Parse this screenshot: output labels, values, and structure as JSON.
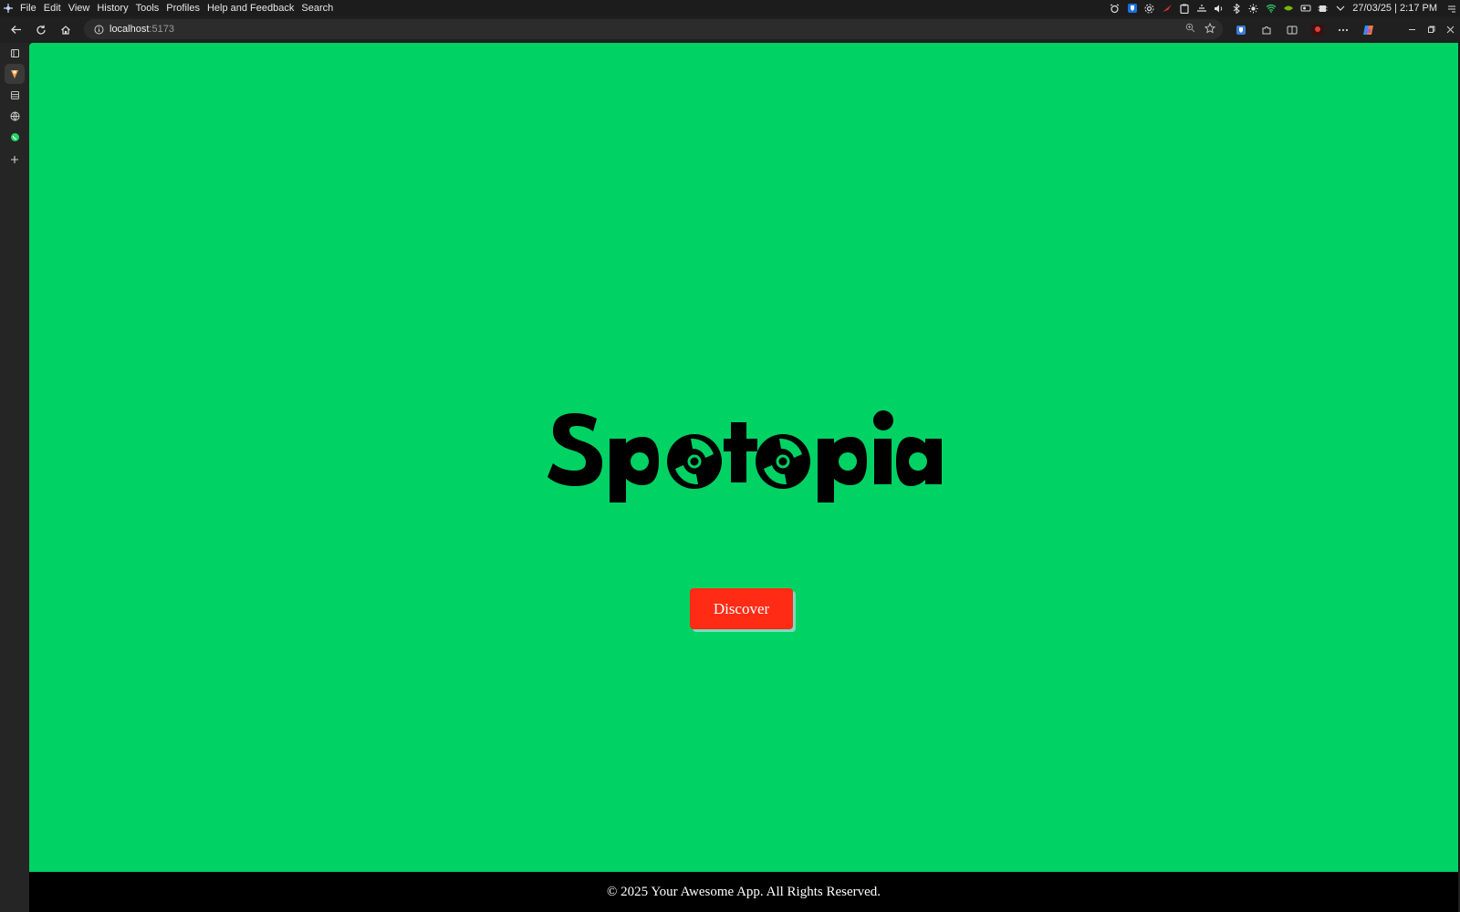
{
  "menubar": {
    "app_icon": "app-menu-icon",
    "items": [
      "File",
      "Edit",
      "View",
      "History",
      "Tools",
      "Profiles",
      "Help and Feedback",
      "Search"
    ],
    "clock": "27/03/25 | 2:17 PM"
  },
  "browser": {
    "url_host": "localhost",
    "url_port": ":5173"
  },
  "page": {
    "logo_text": "Spotopia",
    "discover_label": "Discover",
    "footer_text": "© 2025 Your Awesome App. All Rights Reserved."
  },
  "colors": {
    "page_background": "#00d264",
    "button_background": "#ff2b14",
    "button_shadow": "#7ad9c2",
    "footer_background": "#000000"
  }
}
